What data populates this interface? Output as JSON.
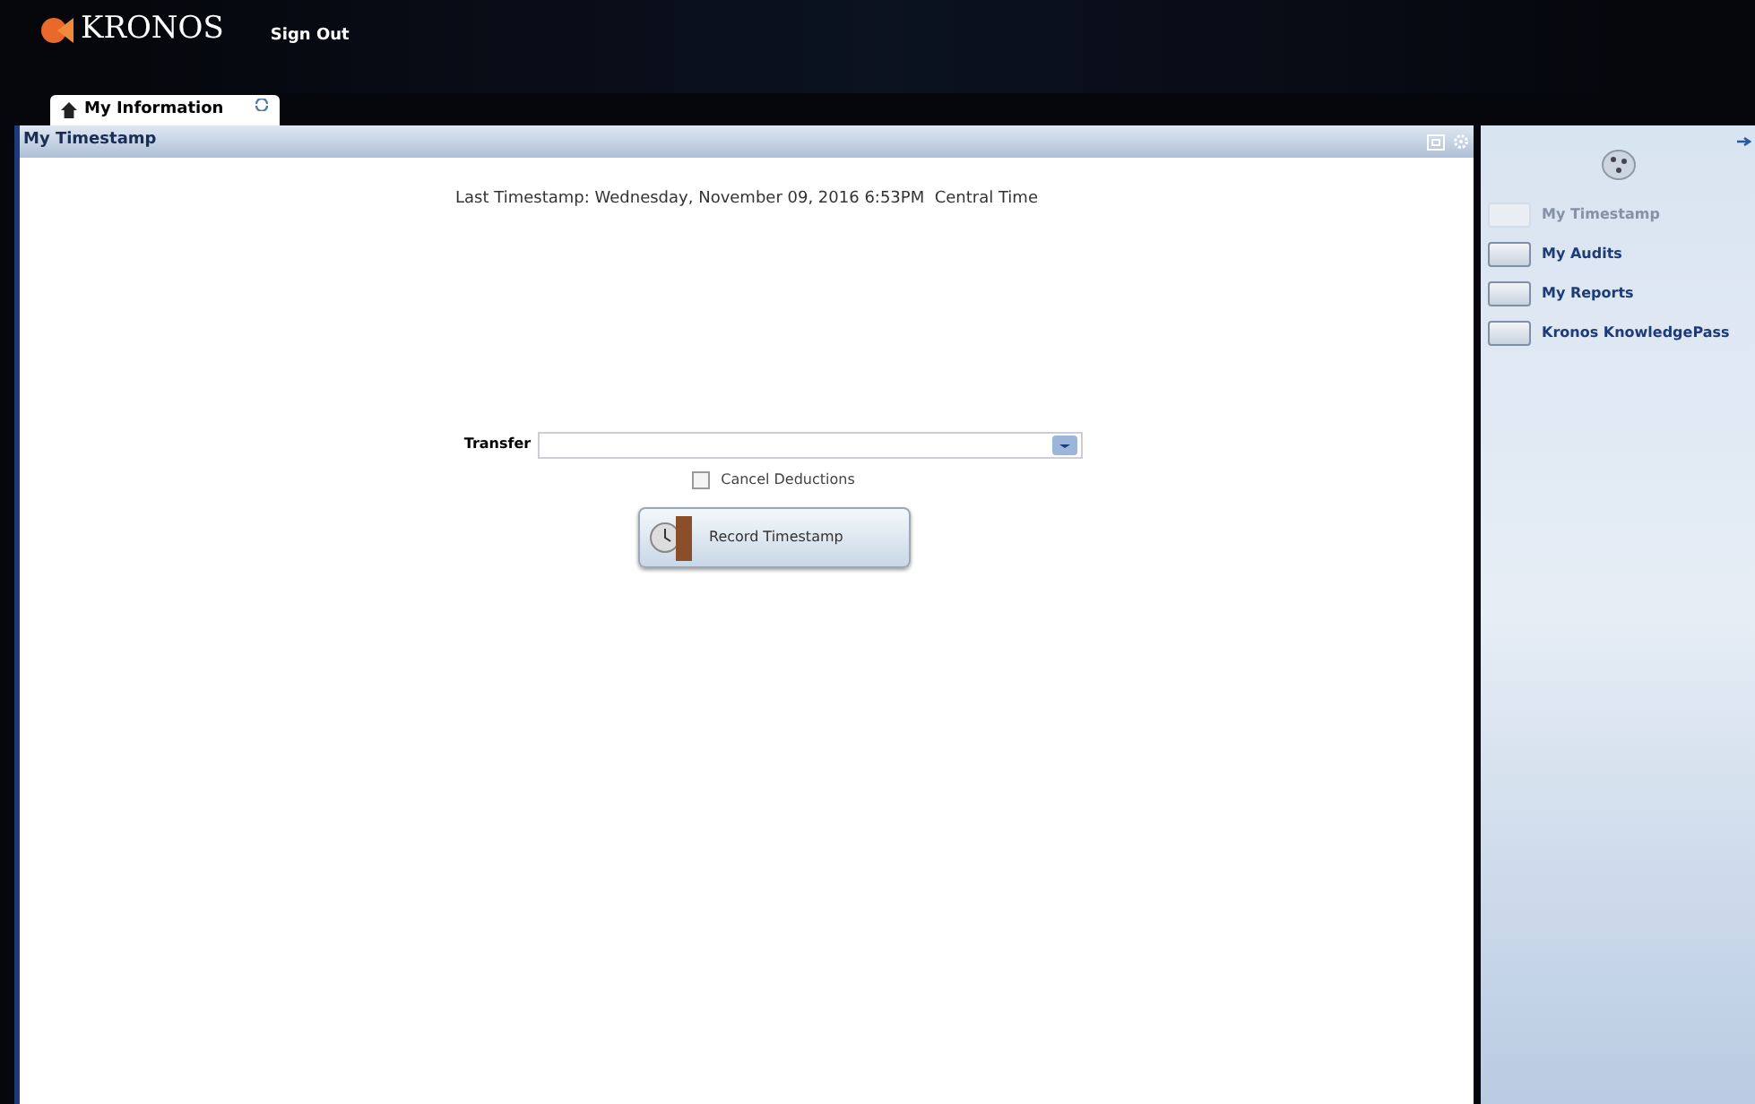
{
  "header": {
    "logo": "KRONOS",
    "sign_out": "Sign Out"
  },
  "tabs": [
    {
      "label": "My Information",
      "selected": true
    }
  ],
  "panel": {
    "title": "My Timestamp",
    "last_timestamp": "Last Timestamp: Wednesday, November 09, 2016 6:53PM  Central Time",
    "transfer_label": "Transfer",
    "cancel_deductions": {
      "label": "Cancel Deductions",
      "checked": false
    },
    "record_button": "Record Timestamp"
  },
  "sidebar": {
    "items": [
      {
        "label": "My Timestamp",
        "disabled": true
      },
      {
        "label": "My Audits",
        "disabled": false
      },
      {
        "label": "My Reports",
        "disabled": false
      },
      {
        "label": "Kronos KnowledgePass",
        "disabled": false
      }
    ]
  }
}
